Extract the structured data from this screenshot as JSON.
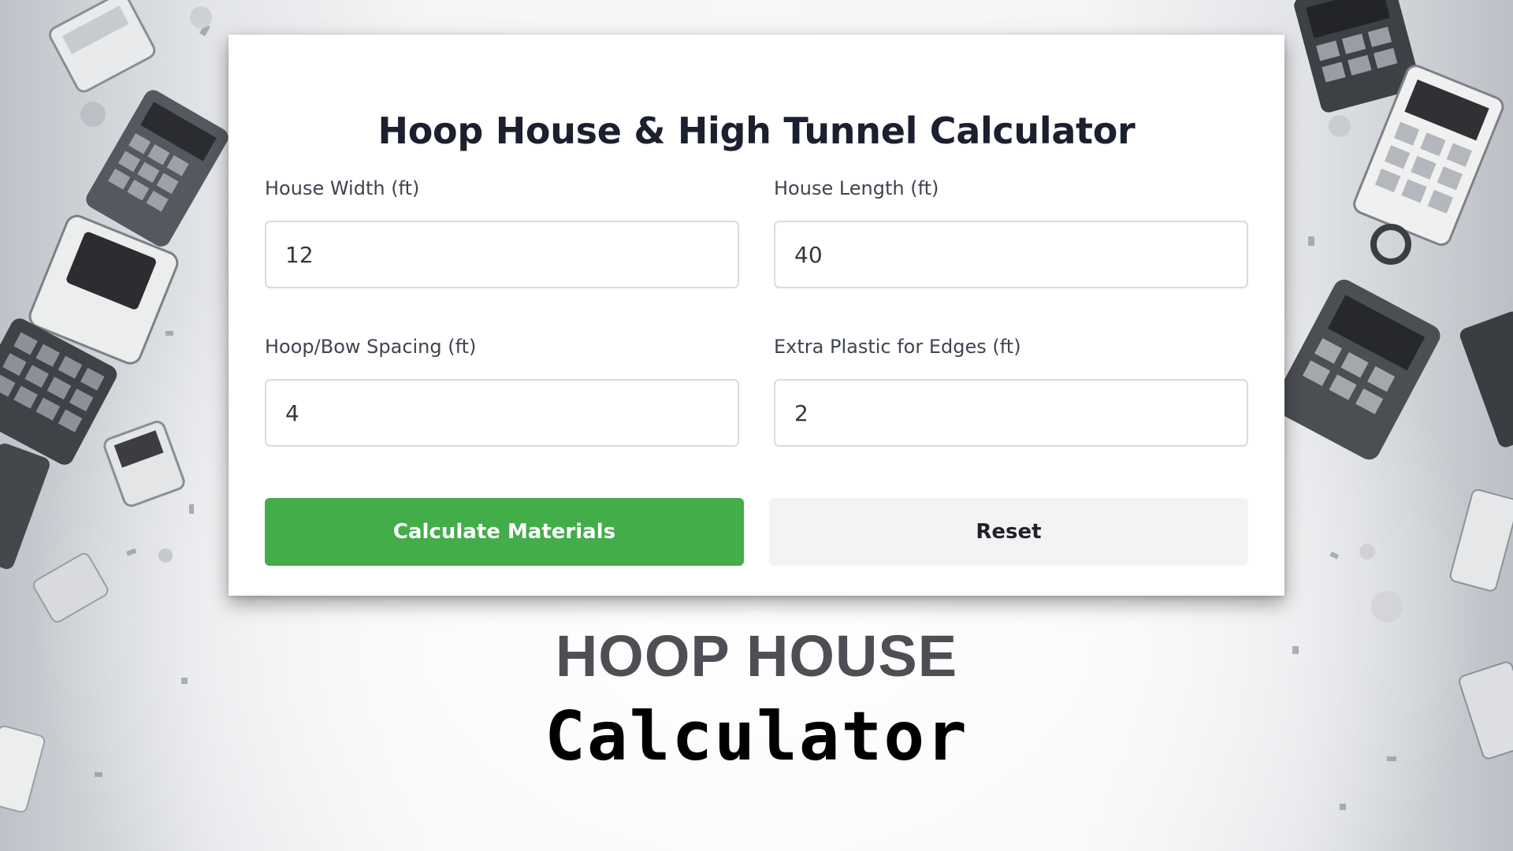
{
  "calculator": {
    "title": "Hoop House & High Tunnel Calculator",
    "fields": [
      {
        "label": "House Width (ft)",
        "value": "12"
      },
      {
        "label": "House Length (ft)",
        "value": "40"
      },
      {
        "label": "Hoop/Bow Spacing (ft)",
        "value": "4"
      },
      {
        "label": "Extra Plastic for Edges (ft)",
        "value": "2"
      }
    ],
    "calculate_label": "Calculate Materials",
    "reset_label": "Reset"
  },
  "caption": {
    "line1": "HOOP HOUSE",
    "line2": "Calculator"
  },
  "colors": {
    "primary_button": "#43ad4a",
    "secondary_button": "#f3f3f4",
    "title_text": "#1c1f2e"
  }
}
